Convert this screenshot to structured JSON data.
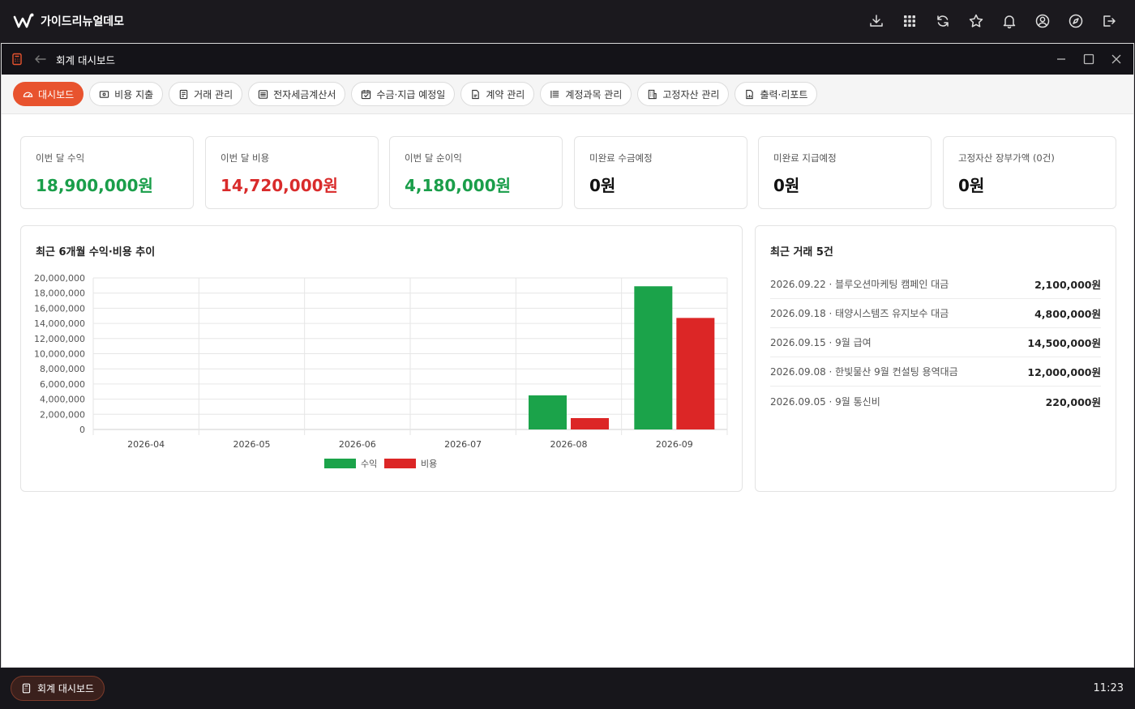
{
  "app": {
    "name": "가이드리뉴얼데모"
  },
  "topbar_icons": [
    "download-icon",
    "apps-grid-icon",
    "refresh-icon",
    "star-icon",
    "bell-icon",
    "user-icon",
    "compass-icon",
    "logout-icon"
  ],
  "window": {
    "title": "회계 대시보드"
  },
  "tabs": [
    {
      "label": "대시보드",
      "icon": "dashboard-gauge-icon",
      "active": true
    },
    {
      "label": "비용 지출",
      "icon": "wallet-icon",
      "active": false
    },
    {
      "label": "거래 관리",
      "icon": "document-icon",
      "active": false
    },
    {
      "label": "전자세금계산서",
      "icon": "invoice-icon",
      "active": false
    },
    {
      "label": "수금·지급 예정일",
      "icon": "calendar-check-icon",
      "active": false
    },
    {
      "label": "계약 관리",
      "icon": "contract-icon",
      "active": false
    },
    {
      "label": "계정과목 관리",
      "icon": "list-icon",
      "active": false
    },
    {
      "label": "고정자산 관리",
      "icon": "building-icon",
      "active": false
    },
    {
      "label": "출력·리포트",
      "icon": "report-icon",
      "active": false
    }
  ],
  "stats": [
    {
      "label": "이번 달 수익",
      "value": "18,900,000원",
      "color": "#1a9e4a"
    },
    {
      "label": "이번 달 비용",
      "value": "14,720,000원",
      "color": "#d92b2b"
    },
    {
      "label": "이번 달 순이익",
      "value": "4,180,000원",
      "color": "#1a9e4a"
    },
    {
      "label": "미완료 수금예정",
      "value": "0원",
      "color": "#111111"
    },
    {
      "label": "미완료 지급예정",
      "value": "0원",
      "color": "#111111"
    },
    {
      "label": "고정자산 장부가액 (0건)",
      "value": "0원",
      "color": "#111111"
    }
  ],
  "chart_panel": {
    "title": "최근 6개월 수익·비용 추이"
  },
  "chart_data": {
    "type": "bar",
    "categories": [
      "2026-04",
      "2026-05",
      "2026-06",
      "2026-07",
      "2026-08",
      "2026-09"
    ],
    "series": [
      {
        "name": "수익",
        "color": "#1ba34a",
        "values": [
          0,
          0,
          0,
          0,
          4500000,
          18900000
        ]
      },
      {
        "name": "비용",
        "color": "#dc2626",
        "values": [
          0,
          0,
          0,
          0,
          1500000,
          14720000
        ]
      }
    ],
    "ylim": [
      0,
      20000000
    ],
    "yticks": [
      0,
      2000000,
      4000000,
      6000000,
      8000000,
      10000000,
      12000000,
      14000000,
      16000000,
      18000000,
      20000000
    ],
    "ytick_labels": [
      "0",
      "2,000,000",
      "4,000,000",
      "6,000,000",
      "8,000,000",
      "10,000,000",
      "12,000,000",
      "14,000,000",
      "16,000,000",
      "18,000,000",
      "20,000,000"
    ],
    "grid": true,
    "legend": "bottom"
  },
  "recent_panel": {
    "title": "최근 거래 5건",
    "rows": [
      {
        "desc": "2026.09.22 · 블루오션마케팅 캠페인 대금",
        "amount": "2,100,000원"
      },
      {
        "desc": "2026.09.18 · 태양시스템즈 유지보수 대금",
        "amount": "4,800,000원"
      },
      {
        "desc": "2026.09.15 · 9월 급여",
        "amount": "14,500,000원"
      },
      {
        "desc": "2026.09.08 · 한빛물산 9월 컨설팅 용역대금",
        "amount": "12,000,000원"
      },
      {
        "desc": "2026.09.05 · 9월 통신비",
        "amount": "220,000원"
      }
    ]
  },
  "taskbar": {
    "item_label": "회계 대시보드",
    "clock": "11:23"
  }
}
